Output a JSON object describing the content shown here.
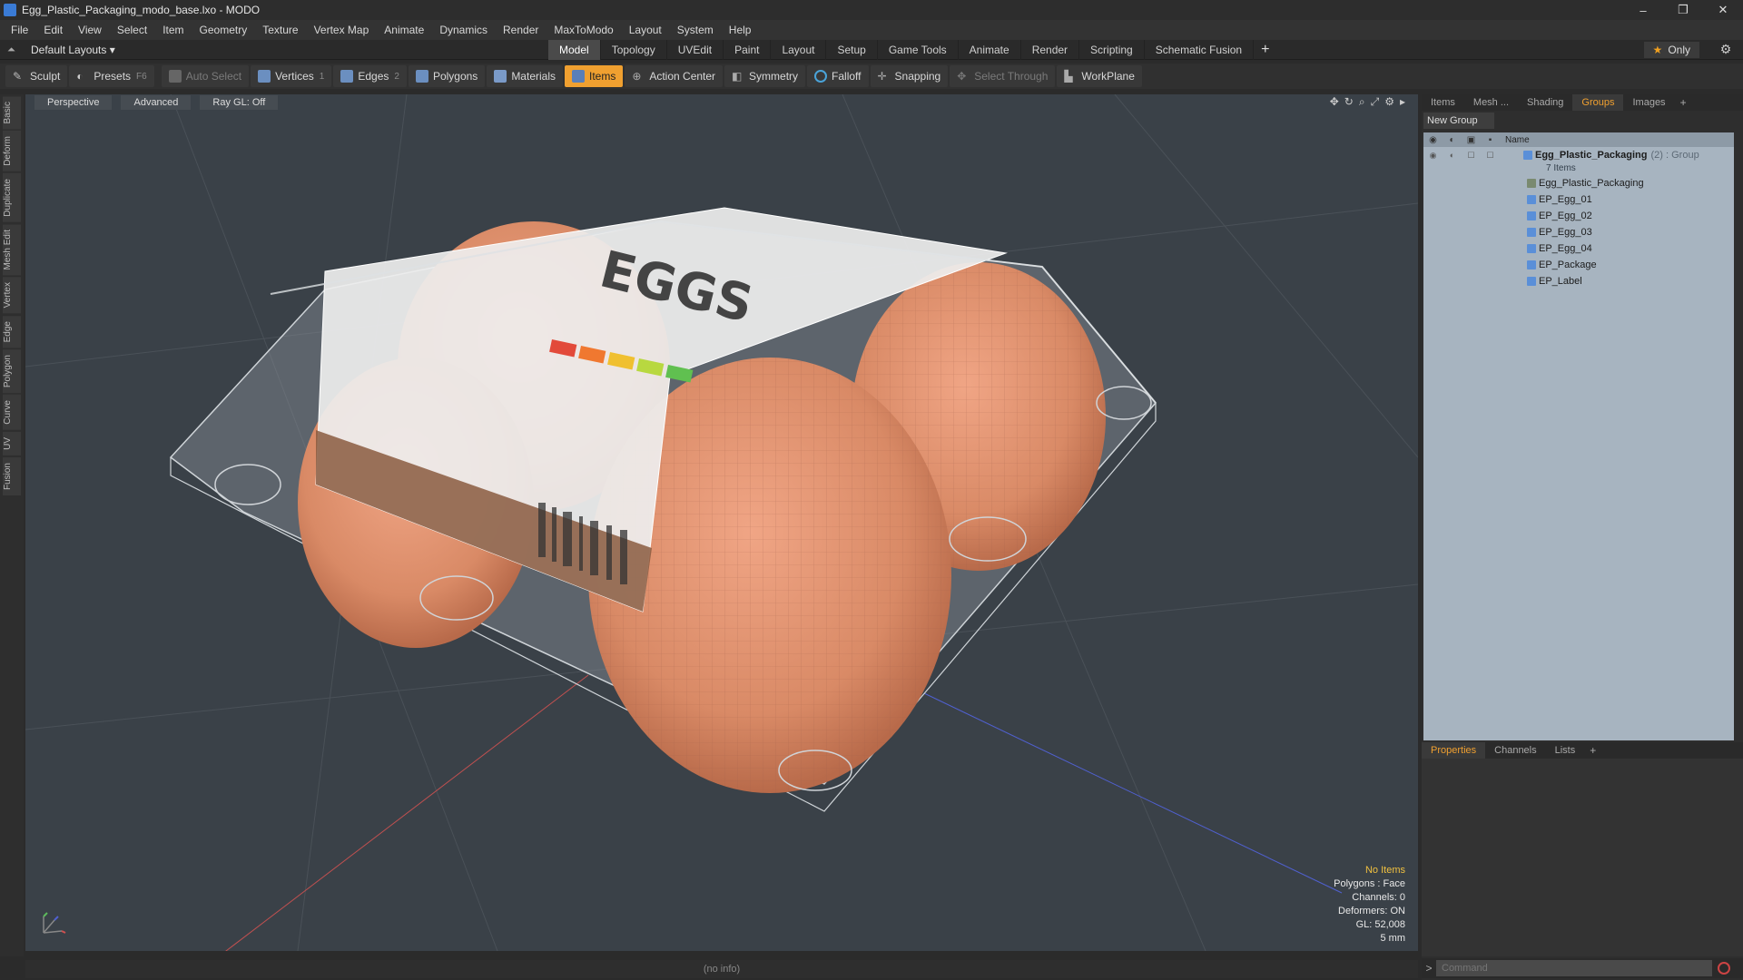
{
  "window": {
    "title": "Egg_Plastic_Packaging_modo_base.lxo - MODO",
    "controls": [
      "–",
      "❐",
      "✕"
    ]
  },
  "menu": [
    "File",
    "Edit",
    "View",
    "Select",
    "Item",
    "Geometry",
    "Texture",
    "Vertex Map",
    "Animate",
    "Dynamics",
    "Render",
    "MaxToModo",
    "Layout",
    "System",
    "Help"
  ],
  "layout": {
    "preset": "Default Layouts ▾",
    "tabs": [
      "Model",
      "Topology",
      "UVEdit",
      "Paint",
      "Layout",
      "Setup",
      "Game Tools",
      "Animate",
      "Render",
      "Scripting",
      "Schematic Fusion"
    ],
    "active_tab": "Model",
    "only_label": "Only"
  },
  "toolbar": {
    "sculpt": "Sculpt",
    "presets": "Presets",
    "presets_key": "F6",
    "auto_select": "Auto Select",
    "vertices": "Vertices",
    "vertices_num": "1",
    "edges": "Edges",
    "edges_num": "2",
    "polygons": "Polygons",
    "materials": "Materials",
    "items": "Items",
    "action_center": "Action Center",
    "symmetry": "Symmetry",
    "falloff": "Falloff",
    "snapping": "Snapping",
    "select_through": "Select Through",
    "workplane": "WorkPlane"
  },
  "left_tabs": [
    "Basic",
    "Deform",
    "Duplicate",
    "Mesh Edit",
    "Vertex",
    "Edge",
    "Polygon",
    "Curve",
    "UV",
    "Fusion"
  ],
  "viewport": {
    "view": "Perspective",
    "shading": "Advanced",
    "raygl": "Ray GL: Off",
    "info": {
      "selection": "No Items",
      "polygons": "Polygons : Face",
      "channels": "Channels: 0",
      "deformers": "Deformers: ON",
      "gl": "GL: 52,008",
      "unit": "5 mm"
    },
    "label_text": "EGGS"
  },
  "status": "(no info)",
  "right_panel": {
    "tabs": [
      "Items",
      "Mesh ...",
      "Shading",
      "Groups",
      "Images"
    ],
    "active_tab": "Groups",
    "new_group": "New Group",
    "name_header": "Name",
    "group": {
      "name": "Egg_Plastic_Packaging",
      "suffix": "(2) : Group",
      "count": "7 Items"
    },
    "items": [
      "Egg_Plastic_Packaging",
      "EP_Egg_01",
      "EP_Egg_02",
      "EP_Egg_03",
      "EP_Egg_04",
      "EP_Package",
      "EP_Label"
    ],
    "props_tabs": [
      "Properties",
      "Channels",
      "Lists"
    ],
    "props_active": "Properties",
    "command_placeholder": "Command"
  },
  "colors": {
    "accent": "#f0a030",
    "viewport_bg": "#3a4148",
    "egg": "#d98a66"
  }
}
